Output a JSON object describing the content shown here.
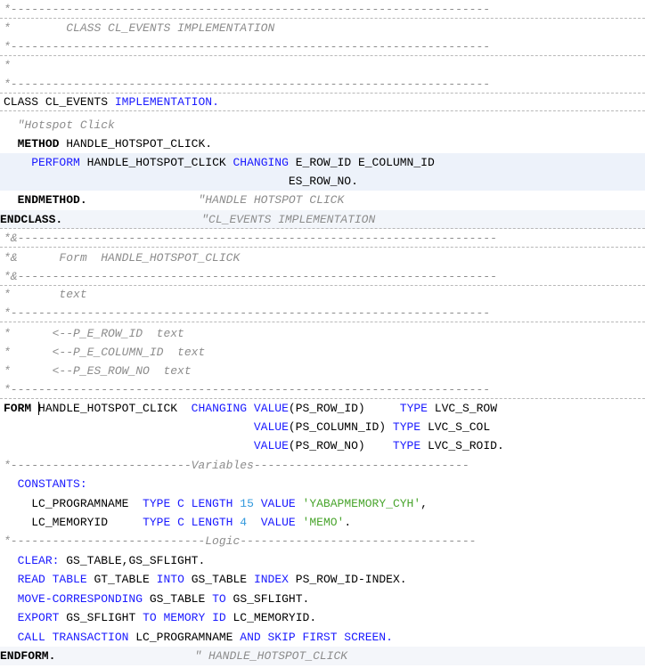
{
  "header_comment": {
    "dash_line": "*---------------------------------------------------------------------",
    "star": "*",
    "title": "CLASS CL_EVENTS IMPLEMENTATION"
  },
  "class_impl": {
    "kw_class": "CLASS",
    "name": "CL_EVENTS",
    "kw_implementation": "IMPLEMENTATION."
  },
  "method": {
    "comment": "\"Hotspot Click",
    "kw_method": "METHOD",
    "name": "HANDLE_HOTSPOT_CLICK.",
    "kw_perform": "PERFORM",
    "form_name": "HANDLE_HOTSPOT_CLICK",
    "kw_changing": "CHANGING",
    "param1": "E_ROW_ID",
    "param2": "E_COLUMN_ID",
    "param3": "ES_ROW_NO.",
    "kw_endmethod": "ENDMETHOD.",
    "end_comment": "\"HANDLE HOTSPOT CLICK"
  },
  "endclass": {
    "kw": "ENDCLASS.",
    "comment": "\"CL_EVENTS IMPLEMENTATION"
  },
  "form_header": {
    "amp_dash": "*&---------------------------------------------------------------------",
    "amp": "*&",
    "dash_line": "*---------------------------------------------------------------------",
    "star": "*",
    "title": "Form  HANDLE_HOTSPOT_CLICK",
    "text": "text",
    "params": [
      "<--P_E_ROW_ID  text",
      "<--P_E_COLUMN_ID  text",
      "<--P_ES_ROW_NO  text"
    ]
  },
  "form": {
    "kw_form": "FORM",
    "name": "HANDLE_HOTSPOT_CLICK",
    "kw_changing": "CHANGING",
    "kw_value": "VALUE",
    "params": [
      {
        "name": "(PS_ROW_ID)",
        "type": "LVC_S_ROW"
      },
      {
        "name": "(PS_COLUMN_ID)",
        "type": "LVC_S_COL"
      },
      {
        "name": "(PS_ROW_NO)",
        "type": "LVC_S_ROID."
      }
    ],
    "kw_type": "TYPE"
  },
  "variables_sep": "*--------------------------Variables-------------------------------",
  "constants": {
    "kw": "CONSTANTS:",
    "items": [
      {
        "name": "LC_PROGRAMNAME",
        "type_kw": "TYPE C LENGTH",
        "length": "15",
        "value_kw": "VALUE",
        "value": "'YABAPMEMORY_CYH'",
        "end": ","
      },
      {
        "name": "LC_MEMORYID",
        "type_kw": "TYPE C LENGTH",
        "length": "4",
        "value_kw": "VALUE",
        "value": "'MEMO'",
        "end": "."
      }
    ]
  },
  "logic_sep": "*----------------------------Logic----------------------------------",
  "statements": {
    "clear_kw": "CLEAR:",
    "clear_args": "GS_TABLE,GS_SFLIGHT.",
    "read_kw1": "READ TABLE",
    "read_tab": "GT_TABLE",
    "read_kw2": "INTO",
    "read_wa": "GS_TABLE",
    "read_kw3": "INDEX",
    "read_idx": "PS_ROW_ID-INDEX.",
    "move_kw": "MOVE-CORRESPONDING",
    "move_src": "GS_TABLE",
    "move_to": "TO",
    "move_dst": "GS_SFLIGHT.",
    "export_kw": "EXPORT",
    "export_obj": "GS_SFLIGHT",
    "export_kw2": "TO MEMORY ID",
    "export_id": "LC_MEMORYID.",
    "call_kw": "CALL TRANSACTION",
    "call_prog": "LC_PROGRAMNAME",
    "call_kw2": "AND SKIP FIRST SCREEN."
  },
  "endform": {
    "kw": "ENDFORM.",
    "comment": "\" HANDLE_HOTSPOT_CLICK"
  }
}
